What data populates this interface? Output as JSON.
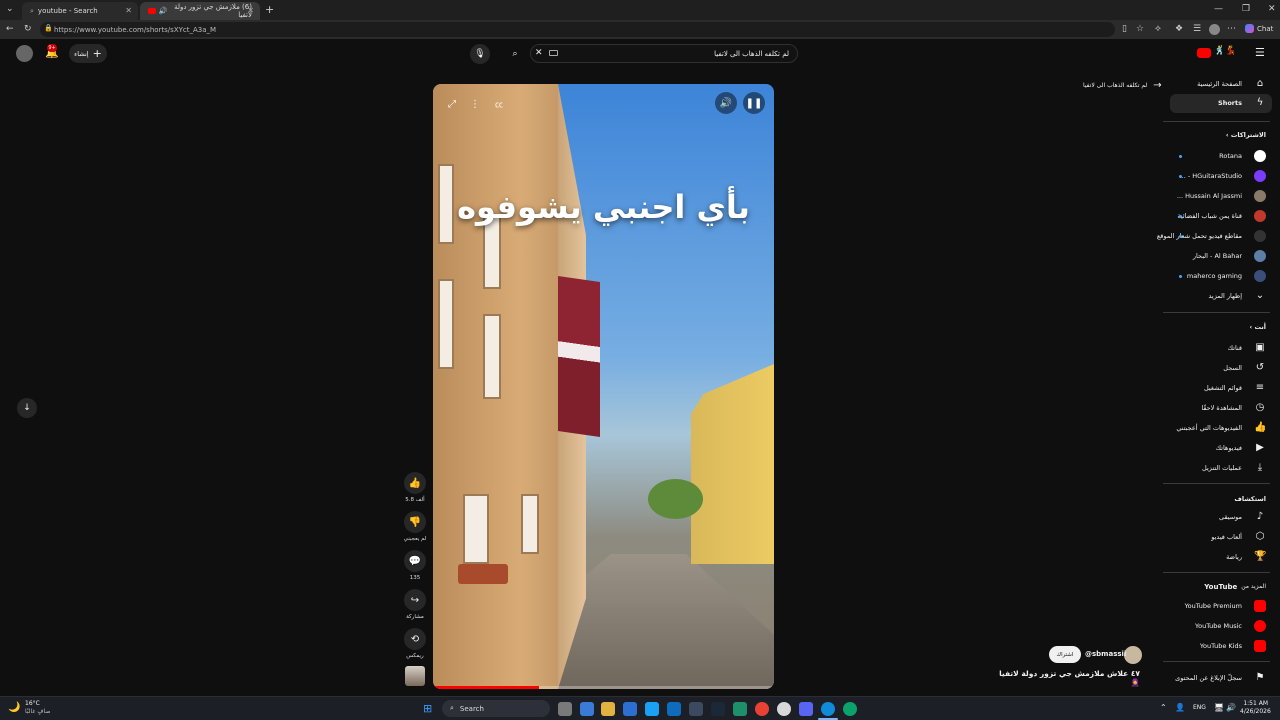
{
  "browser": {
    "tabs": [
      {
        "title": "youtube - Search"
      },
      {
        "title": "(6) ملازمش جي تزور دولة لاتفيا"
      }
    ],
    "url": "https://www.youtube.com/shorts/sXYct_A3a_M",
    "chat_label": "Chat"
  },
  "header": {
    "create_label": "إنشاء",
    "notification_count": "9+",
    "search_value": "لم تكلفه الذهاب الى لاتفيا",
    "search_clear_icon": "close-icon"
  },
  "short": {
    "caption": "بأي اجنبي يشوفوه",
    "title": "٤٧ علاش ملازمش جي تزور دولة لاتفيا 🧕",
    "channel": "@sbmassii",
    "subscribe_label": "اشتراك",
    "actions": {
      "like_count": "5.8 ألف",
      "dislike_label": "لم يعجبني",
      "comments_count": "135",
      "share_label": "مشاركة",
      "remix_label": "ريمكس"
    },
    "progress": 0.31
  },
  "related_link": "لم تكلفه الذهاب الى لاتفيا",
  "sidebar": {
    "home": "الصفحة الرئيسية",
    "shorts": "Shorts",
    "subscriptions_title": "الاشتراكات",
    "subscriptions": [
      {
        "name": "Rotana",
        "color": "#ffffff"
      },
      {
        "name": "HGuitaraStudio - ...",
        "color": "#7a3cff"
      },
      {
        "name": "Hussain Al Jassmi ...",
        "color": "#8a7a6a"
      },
      {
        "name": "قناة يمن شباب الفضائية",
        "color": "#c0392b"
      },
      {
        "name": "مقاطع فيديو تحمل شعار الموقع",
        "color": "#333333"
      },
      {
        "name": "Al Bahar - البحار",
        "color": "#5b7fa6"
      },
      {
        "name": "maherco gaming",
        "color": "#3a4e7a"
      }
    ],
    "show_more": "إظهار المزيد",
    "you_title": "أنت",
    "you_items": [
      "قناتك",
      "السجل",
      "قوائم التشغيل",
      "المشاهدة لاحقًا",
      "الفيديوهات التي أعجبتني",
      "فيديوهاتك",
      "عمليات التنزيل"
    ],
    "explore_title": "استكشاف",
    "explore_items": [
      "موسيقى",
      "ألعاب فيديو",
      "رياضة"
    ],
    "more_title": "المزيد من",
    "more_title_brand": "YouTube",
    "more_items": [
      "YouTube Premium",
      "YouTube Music",
      "YouTube Kids"
    ],
    "report_history": "سجلّ الإبلاغ عن المحتوى"
  },
  "taskbar": {
    "weather_temp": "16°C",
    "weather_desc": "صافٍ غالبًا",
    "search_placeholder": "Search",
    "language": "ENG",
    "time": "1:51 AM",
    "date": "4/26/2026"
  },
  "colors": {
    "youtube_red": "#ff0000",
    "background": "#0f0f0f",
    "accent_blue": "#3ea6ff"
  }
}
